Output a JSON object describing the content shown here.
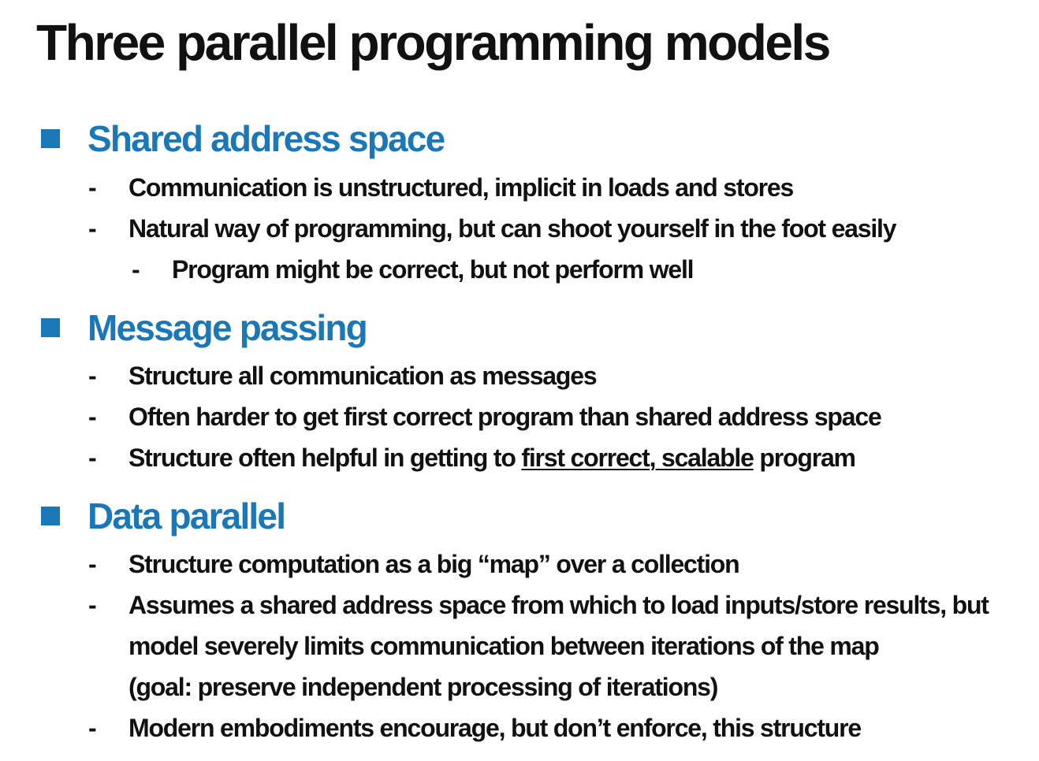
{
  "slide": {
    "title": "Three parallel programming models",
    "accent_color": "#1a77b8",
    "bullet_marker": "-"
  },
  "sections": [
    {
      "heading": "Shared address space",
      "items": [
        "Communication is unstructured, implicit in loads and stores",
        "Natural way of programming, but can shoot yourself in the foot easily"
      ],
      "subitems": [
        "Program might be correct, but not perform well"
      ]
    },
    {
      "heading": "Message passing",
      "items": [
        "Structure all communication as messages",
        "Often harder to get first correct program than shared address space"
      ],
      "item3": {
        "before": "Structure often helpful in getting to ",
        "underlined": "first correct, scalable",
        "after": " program"
      }
    },
    {
      "heading": "Data parallel",
      "items": [
        "Structure computation as a big “map” over a collection",
        "Assumes a shared address space from which to load inputs/store results, but",
        "model severely limits communication between iterations of the map",
        "(goal: preserve independent processing of iterations)",
        "Modern embodiments encourage, but don’t enforce, this structure"
      ]
    }
  ]
}
